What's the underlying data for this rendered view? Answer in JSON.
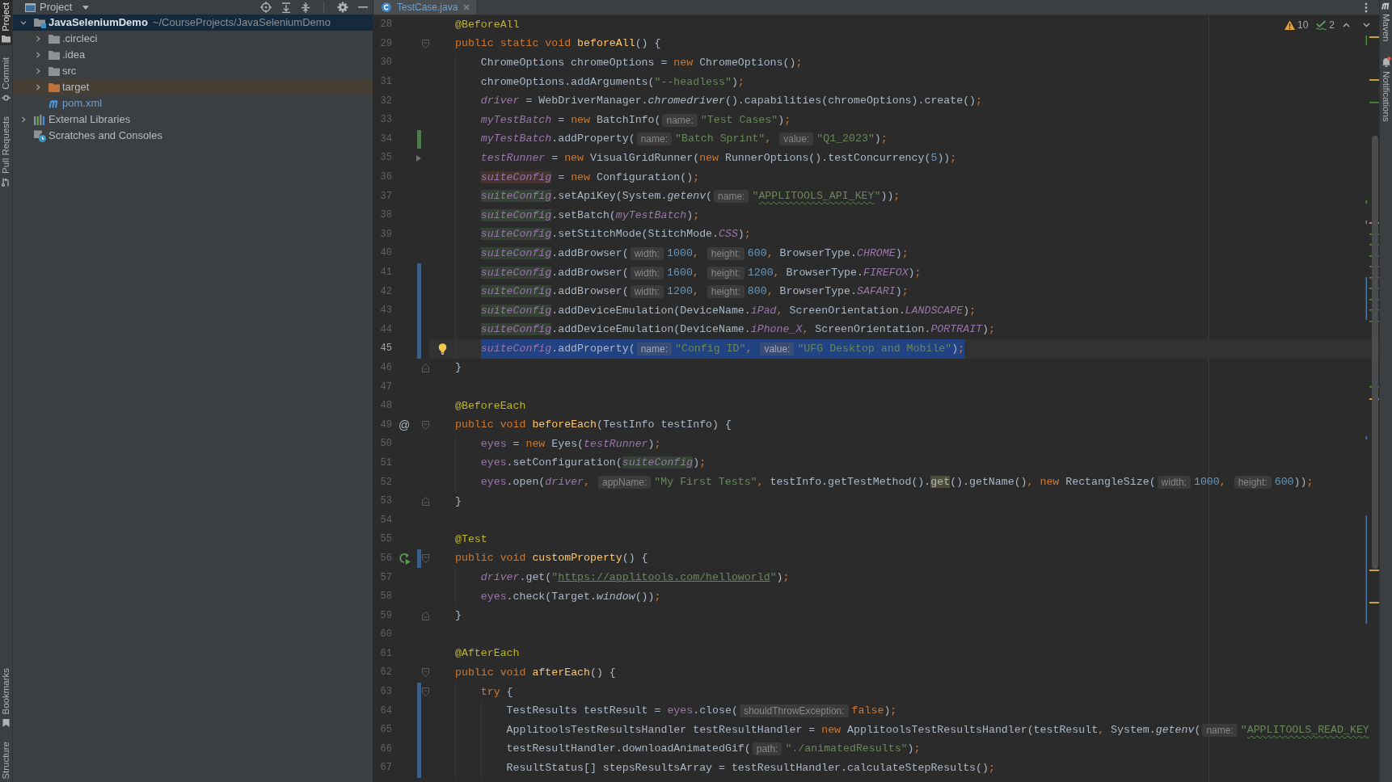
{
  "left_toolbar": {
    "top": [
      {
        "label": "Project",
        "kind": "project",
        "selected": true
      },
      {
        "label": "Commit",
        "kind": "commit",
        "selected": false
      },
      {
        "label": "Pull Requests",
        "kind": "pull-requests",
        "selected": false
      }
    ],
    "bottom": [
      {
        "label": "Bookmarks",
        "kind": "bookmarks",
        "selected": false
      },
      {
        "label": "Structure",
        "selected": false
      }
    ]
  },
  "project_panel": {
    "title": "Project",
    "tree": [
      {
        "label": "JavaSeleniumDemo",
        "path": "~/CourseProjects/JavaSeleniumDemo",
        "kind": "module",
        "expanded": true,
        "selected": true,
        "modified": false,
        "children": [
          {
            "label": ".circleci",
            "kind": "folder",
            "expanded": false,
            "selected": false,
            "modified": false
          },
          {
            "label": ".idea",
            "kind": "folder",
            "expanded": false,
            "selected": false,
            "modified": false
          },
          {
            "label": "src",
            "kind": "folder",
            "expanded": false,
            "selected": false,
            "modified": false
          },
          {
            "label": "target",
            "kind": "excluded-folder",
            "expanded": false,
            "selected": false,
            "modified": false
          },
          {
            "label": "pom.xml",
            "kind": "maven-file",
            "selected": false,
            "modified": true
          }
        ]
      },
      {
        "label": "External Libraries",
        "kind": "libraries",
        "expanded": false,
        "selected": false,
        "modified": false
      },
      {
        "label": "Scratches and Consoles",
        "kind": "scratches",
        "selected": false,
        "modified": false
      }
    ]
  },
  "editor": {
    "tabs": [
      {
        "label": "TestCase.java",
        "selected": true,
        "modified": true
      }
    ],
    "inspections": {
      "warnings": "10",
      "typos": "2"
    },
    "lines": [
      {
        "number": "28",
        "selected": false,
        "tokens": [
          {
            "kind": "annotation",
            "text": "@BeforeAll"
          }
        ]
      },
      {
        "number": "29",
        "selected": false,
        "fold": {
          "kind": "start"
        },
        "tokens": [
          {
            "kind": "keyword",
            "text": "public static void "
          },
          {
            "kind": "method",
            "text": "beforeAll"
          },
          "() {"
        ],
        "children": [
          {
            "number": "30",
            "selected": false,
            "tokens": [
              "ChromeOptions chromeOptions = ",
              {
                "kind": "keyword",
                "text": "new"
              },
              " ChromeOptions()",
              {
                "kind": "punct",
                "text": ";"
              }
            ]
          },
          {
            "number": "31",
            "selected": false,
            "tokens": [
              "chromeOptions.addArguments(",
              {
                "kind": "string",
                "text": "\"--headless\""
              },
              ")",
              {
                "kind": "punct",
                "text": ";"
              }
            ]
          },
          {
            "number": "32",
            "selected": false,
            "tokens": [
              {
                "kind": "static-field",
                "text": "driver"
              },
              " = WebDriverManager.",
              {
                "kind": "static-call",
                "text": "chromedriver"
              },
              "().capabilities(chromeOptions).create()",
              {
                "kind": "punct",
                "text": ";"
              }
            ]
          },
          {
            "number": "33",
            "selected": false,
            "tokens": [
              {
                "kind": "static-field",
                "text": "myTestBatch"
              },
              " = ",
              {
                "kind": "keyword",
                "text": "new"
              },
              " BatchInfo(",
              {
                "kind": "hint",
                "text": "name:"
              },
              {
                "kind": "string",
                "text": "\"Test Cases\""
              },
              ")",
              {
                "kind": "punct",
                "text": ";"
              }
            ]
          },
          {
            "number": "34",
            "selected": false,
            "change": {
              "kind": "added"
            },
            "tokens": [
              {
                "kind": "static-field",
                "text": "myTestBatch"
              },
              ".addProperty(",
              {
                "kind": "hint",
                "text": "name:"
              },
              {
                "kind": "string",
                "text": "\"Batch Sprint\""
              },
              {
                "kind": "punct",
                "text": ", "
              },
              {
                "kind": "hint",
                "text": "value:"
              },
              {
                "kind": "string",
                "text": "\"Q1_2023\""
              },
              ")",
              {
                "kind": "punct",
                "text": ";"
              }
            ]
          },
          {
            "number": "35",
            "selected": false,
            "change": {
              "kind": "deleted"
            },
            "tokens": [
              {
                "kind": "static-field",
                "text": "testRunner"
              },
              " = ",
              {
                "kind": "keyword",
                "text": "new"
              },
              " VisualGridRunner(",
              {
                "kind": "keyword",
                "text": "new"
              },
              " RunnerOptions().testConcurrency(",
              {
                "kind": "number",
                "text": "5"
              },
              "))",
              {
                "kind": "punct",
                "text": ";"
              }
            ]
          },
          {
            "number": "36",
            "selected": false,
            "tokens": [
              {
                "kind": "static-field",
                "text": "suiteConfig",
                "usage": {
                  "kind": "write"
                }
              },
              " = ",
              {
                "kind": "keyword",
                "text": "new"
              },
              " Configuration()",
              {
                "kind": "punct",
                "text": ";"
              }
            ]
          },
          {
            "number": "37",
            "selected": false,
            "tokens": [
              {
                "kind": "static-field",
                "text": "suiteConfig",
                "usage": {
                  "kind": "read"
                }
              },
              ".setApiKey(System.",
              {
                "kind": "static-call",
                "text": "getenv"
              },
              "(",
              {
                "kind": "hint",
                "text": "name:"
              },
              {
                "kind": "string",
                "text": "\""
              },
              {
                "kind": "typo",
                "text": "APPLITOOLS_API_KEY"
              },
              {
                "kind": "string",
                "text": "\""
              },
              "))",
              {
                "kind": "punct",
                "text": ";"
              }
            ]
          },
          {
            "number": "38",
            "selected": false,
            "tokens": [
              {
                "kind": "static-field",
                "text": "suiteConfig",
                "usage": {
                  "kind": "read"
                }
              },
              ".setBatch(",
              {
                "kind": "static-field",
                "text": "myTestBatch"
              },
              ")",
              {
                "kind": "punct",
                "text": ";"
              }
            ]
          },
          {
            "number": "39",
            "selected": false,
            "tokens": [
              {
                "kind": "static-field",
                "text": "suiteConfig",
                "usage": {
                  "kind": "read"
                }
              },
              ".setStitchMode(StitchMode.",
              {
                "kind": "constant",
                "text": "CSS"
              },
              ")",
              {
                "kind": "punct",
                "text": ";"
              }
            ]
          },
          {
            "number": "40",
            "selected": false,
            "tokens": [
              {
                "kind": "static-field",
                "text": "suiteConfig",
                "usage": {
                  "kind": "read"
                }
              },
              ".addBrowser(",
              {
                "kind": "hint",
                "text": "width:"
              },
              {
                "kind": "number",
                "text": "1000"
              },
              {
                "kind": "punct",
                "text": ", "
              },
              {
                "kind": "hint",
                "text": "height:"
              },
              {
                "kind": "number",
                "text": "600"
              },
              {
                "kind": "punct",
                "text": ", "
              },
              "BrowserType.",
              {
                "kind": "constant",
                "text": "CHROME"
              },
              ")",
              {
                "kind": "punct",
                "text": ";"
              }
            ]
          },
          {
            "number": "41",
            "selected": false,
            "change": {
              "kind": "modified"
            },
            "tokens": [
              {
                "kind": "static-field",
                "text": "suiteConfig",
                "usage": {
                  "kind": "read"
                }
              },
              ".addBrowser(",
              {
                "kind": "hint",
                "text": "width:"
              },
              {
                "kind": "number",
                "text": "1600"
              },
              {
                "kind": "punct",
                "text": ", "
              },
              {
                "kind": "hint",
                "text": "height:"
              },
              {
                "kind": "number",
                "text": "1200"
              },
              {
                "kind": "punct",
                "text": ", "
              },
              "BrowserType.",
              {
                "kind": "constant",
                "text": "FIREFOX"
              },
              ")",
              {
                "kind": "punct",
                "text": ";"
              }
            ]
          },
          {
            "number": "42",
            "selected": false,
            "change": {
              "kind": "modified"
            },
            "tokens": [
              {
                "kind": "static-field",
                "text": "suiteConfig",
                "usage": {
                  "kind": "read"
                }
              },
              ".addBrowser(",
              {
                "kind": "hint",
                "text": "width:"
              },
              {
                "kind": "number",
                "text": "1200"
              },
              {
                "kind": "punct",
                "text": ", "
              },
              {
                "kind": "hint",
                "text": "height:"
              },
              {
                "kind": "number",
                "text": "800"
              },
              {
                "kind": "punct",
                "text": ", "
              },
              "BrowserType.",
              {
                "kind": "constant",
                "text": "SAFARI"
              },
              ")",
              {
                "kind": "punct",
                "text": ";"
              }
            ]
          },
          {
            "number": "43",
            "selected": false,
            "change": {
              "kind": "modified"
            },
            "tokens": [
              {
                "kind": "static-field",
                "text": "suiteConfig",
                "usage": {
                  "kind": "read"
                }
              },
              ".addDeviceEmulation(DeviceName.",
              {
                "kind": "constant",
                "text": "iPad"
              },
              {
                "kind": "punct",
                "text": ", "
              },
              "ScreenOrientation.",
              {
                "kind": "constant",
                "text": "LANDSCAPE"
              },
              ")",
              {
                "kind": "punct",
                "text": ";"
              }
            ]
          },
          {
            "number": "44",
            "selected": false,
            "change": {
              "kind": "modified"
            },
            "tokens": [
              {
                "kind": "static-field",
                "text": "suiteConfig",
                "usage": {
                  "kind": "read"
                }
              },
              ".addDeviceEmulation(DeviceName.",
              {
                "kind": "constant",
                "text": "iPhone_X"
              },
              {
                "kind": "punct",
                "text": ", "
              },
              "ScreenOrientation.",
              {
                "kind": "constant",
                "text": "PORTRAIT"
              },
              ")",
              {
                "kind": "punct",
                "text": ";"
              }
            ]
          },
          {
            "number": "45",
            "selected": true,
            "change": {
              "kind": "modified"
            },
            "marker": {
              "kind": "intention"
            },
            "tokens": [
              {
                "kind": "static-field",
                "text": "suiteConfig"
              },
              ".addProperty(",
              {
                "kind": "hint",
                "text": "name:"
              },
              {
                "kind": "string",
                "text": "\"Config ID\""
              },
              {
                "kind": "punct",
                "text": ", "
              },
              {
                "kind": "hint",
                "text": "value:"
              },
              {
                "kind": "string",
                "text": "\"UFG Desktop and Mobile\""
              },
              ")",
              {
                "kind": "punct",
                "text": ";"
              }
            ]
          }
        ]
      },
      {
        "number": "46",
        "selected": false,
        "fold": {
          "kind": "end"
        },
        "tokens": [
          "}"
        ]
      },
      {
        "number": "47",
        "selected": false
      },
      {
        "number": "48",
        "selected": false,
        "tokens": [
          {
            "kind": "annotation",
            "text": "@BeforeEach"
          }
        ]
      },
      {
        "number": "49",
        "selected": false,
        "fold": {
          "kind": "start"
        },
        "gutter_text": "@",
        "tokens": [
          {
            "kind": "keyword",
            "text": "public void "
          },
          {
            "kind": "method",
            "text": "beforeEach"
          },
          "(TestInfo testInfo) {"
        ],
        "children": [
          {
            "number": "50",
            "selected": false,
            "tokens": [
              {
                "kind": "field",
                "text": "eyes"
              },
              " = ",
              {
                "kind": "keyword",
                "text": "new"
              },
              " Eyes(",
              {
                "kind": "static-field",
                "text": "testRunner"
              },
              ")",
              {
                "kind": "punct",
                "text": ";"
              }
            ]
          },
          {
            "number": "51",
            "selected": false,
            "tokens": [
              {
                "kind": "field",
                "text": "eyes"
              },
              ".setConfiguration(",
              {
                "kind": "static-field",
                "text": "suiteConfig",
                "usage": {
                  "kind": "read"
                }
              },
              ")",
              {
                "kind": "punct",
                "text": ";"
              }
            ]
          },
          {
            "number": "52",
            "selected": false,
            "tokens": [
              {
                "kind": "field",
                "text": "eyes"
              },
              ".open(",
              {
                "kind": "static-field",
                "text": "driver"
              },
              {
                "kind": "punct",
                "text": ", "
              },
              {
                "kind": "hint",
                "text": "appName:"
              },
              {
                "kind": "string",
                "text": "\"My First Tests\""
              },
              {
                "kind": "punct",
                "text": ", "
              },
              "testInfo.getTestMethod().",
              {
                "kind": "plain",
                "text": "get",
                "usage": {
                  "kind": "match"
                }
              },
              "().getName()",
              {
                "kind": "punct",
                "text": ", "
              },
              {
                "kind": "keyword",
                "text": "new"
              },
              " RectangleSize(",
              {
                "kind": "hint",
                "text": "width:"
              },
              {
                "kind": "number",
                "text": "1000"
              },
              {
                "kind": "punct",
                "text": ", "
              },
              {
                "kind": "hint",
                "text": "height:"
              },
              {
                "kind": "number",
                "text": "600"
              },
              "))",
              {
                "kind": "punct",
                "text": ";"
              }
            ]
          }
        ]
      },
      {
        "number": "53",
        "selected": false,
        "fold": {
          "kind": "end"
        },
        "tokens": [
          "}"
        ]
      },
      {
        "number": "54",
        "selected": false
      },
      {
        "number": "55",
        "selected": false,
        "tokens": [
          {
            "kind": "annotation",
            "text": "@Test"
          }
        ]
      },
      {
        "number": "56",
        "selected": false,
        "fold": {
          "kind": "start"
        },
        "marker": {
          "kind": "run"
        },
        "change": {
          "kind": "modified"
        },
        "tokens": [
          {
            "kind": "keyword",
            "text": "public void "
          },
          {
            "kind": "method",
            "text": "customProperty"
          },
          "() {"
        ],
        "children": [
          {
            "number": "57",
            "selected": false,
            "tokens": [
              {
                "kind": "static-field",
                "text": "driver"
              },
              ".get(",
              {
                "kind": "string",
                "text": "\""
              },
              {
                "kind": "link",
                "text": "https://applitools.com/helloworld"
              },
              {
                "kind": "string",
                "text": "\""
              },
              ")",
              {
                "kind": "punct",
                "text": ";"
              }
            ]
          },
          {
            "number": "58",
            "selected": false,
            "tokens": [
              {
                "kind": "field",
                "text": "eyes"
              },
              ".check(Target.",
              {
                "kind": "static-call",
                "text": "window"
              },
              "())",
              {
                "kind": "punct",
                "text": ";"
              }
            ]
          }
        ]
      },
      {
        "number": "59",
        "selected": false,
        "fold": {
          "kind": "end"
        },
        "tokens": [
          "}"
        ]
      },
      {
        "number": "60",
        "selected": false
      },
      {
        "number": "61",
        "selected": false,
        "tokens": [
          {
            "kind": "annotation",
            "text": "@AfterEach"
          }
        ]
      },
      {
        "number": "62",
        "selected": false,
        "fold": {
          "kind": "start"
        },
        "tokens": [
          {
            "kind": "keyword",
            "text": "public void "
          },
          {
            "kind": "method",
            "text": "afterEach"
          },
          "() {"
        ],
        "children": [
          {
            "number": "63",
            "selected": false,
            "fold": {
              "kind": "start"
            },
            "change": {
              "kind": "modified"
            },
            "tokens": [
              {
                "kind": "keyword",
                "text": "try"
              },
              " {"
            ],
            "children": [
              {
                "number": "64",
                "selected": false,
                "change": {
                  "kind": "modified"
                },
                "tokens": [
                  "TestResults testResult = ",
                  {
                    "kind": "field",
                    "text": "eyes"
                  },
                  ".close(",
                  {
                    "kind": "hint",
                    "text": "shouldThrowException:"
                  },
                  {
                    "kind": "keyword",
                    "text": "false"
                  },
                  ")",
                  {
                    "kind": "punct",
                    "text": ";"
                  }
                ]
              },
              {
                "number": "65",
                "selected": false,
                "change": {
                  "kind": "modified"
                },
                "tokens": [
                  "ApplitoolsTestResultsHandler testResultHandler = ",
                  {
                    "kind": "keyword",
                    "text": "new"
                  },
                  " ApplitoolsTestResultsHandler(testResult",
                  {
                    "kind": "punct",
                    "text": ", "
                  },
                  "System.",
                  {
                    "kind": "static-call",
                    "text": "getenv"
                  },
                  "(",
                  {
                    "kind": "hint",
                    "text": "name:"
                  },
                  {
                    "kind": "string",
                    "text": "\""
                  },
                  {
                    "kind": "typo",
                    "text": "APPLITOOLS_READ_KEY"
                  }
                ]
              },
              {
                "number": "66",
                "selected": false,
                "change": {
                  "kind": "modified"
                },
                "tokens": [
                  "testResultHandler.downloadAnimatedGif(",
                  {
                    "kind": "hint",
                    "text": "path:"
                  },
                  {
                    "kind": "string",
                    "text": "\"./animatedResults\""
                  },
                  ")",
                  {
                    "kind": "punct",
                    "text": ";"
                  }
                ]
              },
              {
                "number": "67",
                "selected": false,
                "change": {
                  "kind": "modified"
                },
                "tokens": [
                  "ResultStatus[] stepsResultsArray = testResultHandler.calculateStepResults()",
                  {
                    "kind": "punct",
                    "text": ";"
                  }
                ]
              }
            ]
          }
        ]
      }
    ]
  },
  "right_toolbar": [
    {
      "label": "Maven",
      "kind": "maven"
    },
    {
      "label": "Notifications",
      "kind": "notifications",
      "unread": true
    }
  ]
}
